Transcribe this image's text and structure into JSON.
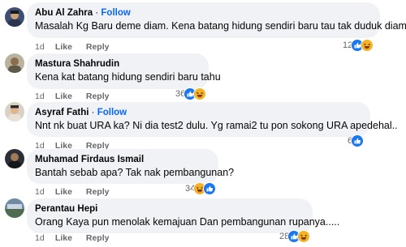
{
  "comments": [
    {
      "author": "Abu Al Zahra",
      "separator": "·",
      "follow": "Follow",
      "text": "Masalah Kg Baru deme diam. Kena batang hidung sendiri baru tau tak duduk diam",
      "time": "1d",
      "like": "Like",
      "reply": "Reply",
      "reaction_count": "12",
      "reactions": [
        "like-icon",
        "haha-icon"
      ]
    },
    {
      "author": "Mastura Shahrudin",
      "text": "Kena kat batang hidung sendiri baru tahu",
      "time": "1d",
      "like": "Like",
      "reply": "Reply",
      "reaction_count": "36",
      "reactions": [
        "like-icon",
        "haha-icon"
      ]
    },
    {
      "author": "Asyraf Fathi",
      "separator": "·",
      "follow": "Follow",
      "text": "Nnt nk buat URA ka? Ni dia test2 dulu. Yg ramai2 tu pon sokong URA apedehal..",
      "time": "1d",
      "like": "Like",
      "reply": "Reply",
      "reaction_count": "6",
      "reactions": [
        "like-icon"
      ]
    },
    {
      "author": "Muhamad Firdaus Ismail",
      "text": "Bantah sebab apa? Tak nak pembangunan?",
      "time": "1d",
      "like": "Like",
      "reply": "Reply",
      "reaction_count": "34",
      "reactions": [
        "haha-icon",
        "like-icon"
      ]
    },
    {
      "author": "Perantau Hepi",
      "text": "Orang Kaya pun menolak kemajuan Dan pembangunan rupanya.....",
      "time": "1d",
      "like": "Like",
      "reply": "Reply",
      "reaction_count": "28",
      "reactions": [
        "like-icon",
        "haha-icon"
      ]
    }
  ],
  "colors": {
    "bubble": "#f0f2f5",
    "follow": "#0866ff",
    "like_reaction": "#1877f2",
    "haha_reaction": "#f7b125",
    "meta_text": "#65676b"
  }
}
